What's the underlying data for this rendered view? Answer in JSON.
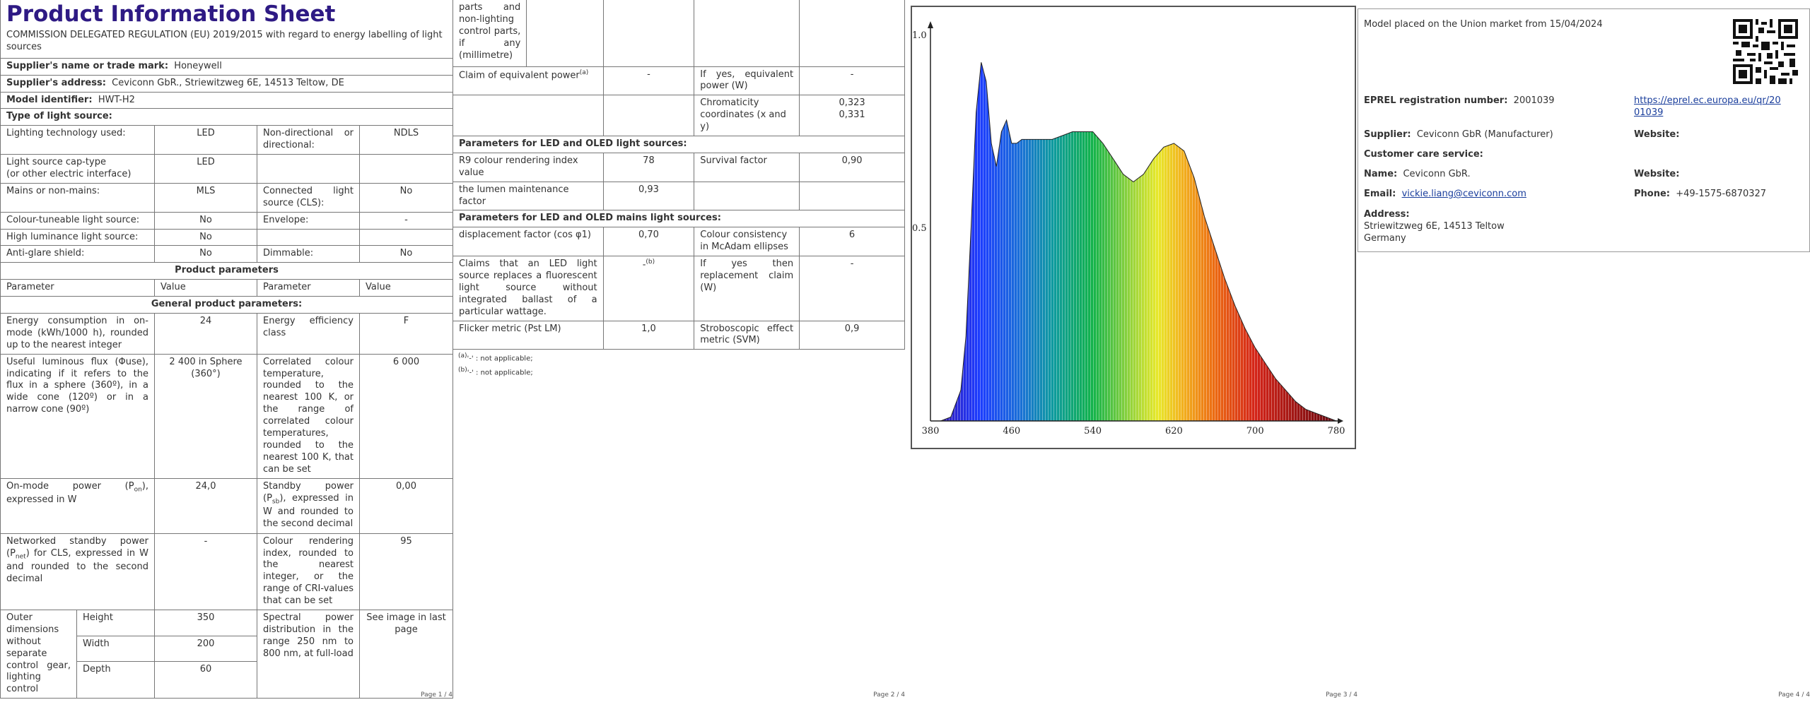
{
  "page1": {
    "title": "Product Information Sheet",
    "regulation": "COMMISSION DELEGATED REGULATION (EU) 2019/2015 with regard to energy labelling of light sources",
    "supplier_name_label": "Supplier's name or trade mark:",
    "supplier_name": "Honeywell",
    "supplier_address_label": "Supplier's address:",
    "supplier_address": "Ceviconn GbR., Striewitzweg 6E, 14513 Teltow, DE",
    "model_label": "Model identifier:",
    "model": "HWT-H2",
    "type_heading": "Type of light source:",
    "type_rows": [
      {
        "p1": "Lighting technology used:",
        "v1": "LED",
        "p2": "Non-directional or directional:",
        "v2": "NDLS"
      },
      {
        "p1": "Light source cap-type\n(or other electric interface)",
        "v1": "LED",
        "p2": "",
        "v2": ""
      },
      {
        "p1": "Mains or non-mains:",
        "v1": "MLS",
        "p2": "Connected light source (CLS):",
        "v2": "No"
      },
      {
        "p1": "Colour-tuneable light source:",
        "v1": "No",
        "p2": "Envelope:",
        "v2": "-"
      },
      {
        "p1": "High luminance light source:",
        "v1": "No",
        "p2": "",
        "v2": ""
      },
      {
        "p1": "Anti-glare shield:",
        "v1": "No",
        "p2": "Dimmable:",
        "v2": "No"
      }
    ],
    "product_params_heading": "Product parameters",
    "col_parameter": "Parameter",
    "col_value": "Value",
    "col_parameter2": "Parameter",
    "col_value2": "Value",
    "general_heading": "General product parameters:",
    "energy_label": "Energy consumption in on-mode (kWh/1000 h), rounded up to the nearest integer",
    "energy_value": "24",
    "eff_class_label": "Energy efficiency class",
    "eff_class_value": "F",
    "flux_label": "Useful luminous flux (Φuse), indicating if it refers to the flux in a sphere (360º), in a wide cone (120º) or in a narrow cone (90º)",
    "flux_value": "2 400 in Sphere (360°)",
    "cct_label": "Correlated colour temperature, rounded to the nearest 100 K, or the range of correlated colour temperatures, rounded to the nearest 100 K, that can be set",
    "cct_value": "6 000",
    "pon_label_a": "On-mode power (P",
    "pon_sub": "on",
    "pon_label_b": "), expressed in W",
    "pon_value": "24,0",
    "psb_label_a": "Standby power (P",
    "psb_sub": "sb",
    "psb_label_b": "), expressed in W and rounded to the second decimal",
    "psb_value": "0,00",
    "pnet_label_a": "Networked standby power (P",
    "pnet_sub": "net",
    "pnet_label_b": ") for CLS, expressed in W and rounded to the second decimal",
    "pnet_value": "-",
    "cri_label": "Colour rendering index, rounded to the nearest integer, or the range of CRI-values that can be set",
    "cri_value": "95",
    "outer_label": "Outer dimensions without separate control gear, lighting control",
    "height_label": "Height",
    "height_value": "350",
    "width_label": "Width",
    "width_value": "200",
    "depth_label": "Depth",
    "depth_value": "60",
    "spd_label": "Spectral power distribution in the range 250 nm to 800 nm, at full-load",
    "spd_value": "See image in last page",
    "page_num": "Page 1 / 4"
  },
  "page2": {
    "cont_text": "parts and non-lighting control parts, if any (millimetre)",
    "equiv_claim_label": "Claim of equivalent power",
    "equiv_claim_sup": "(a)",
    "equiv_claim_value": "-",
    "equiv_power_label": "If yes, equivalent power (W)",
    "equiv_power_value": "-",
    "chroma_label": "Chromaticity coordinates (x and y)",
    "chroma_x": "0,323",
    "chroma_y": "0,331",
    "led_heading": "Parameters for LED and OLED light sources:",
    "r9_label": "R9 colour rendering index value",
    "r9_value": "78",
    "survival_label": "Survival factor",
    "survival_value": "0,90",
    "lumen_label": "the lumen maintenance factor",
    "lumen_value": "0,93",
    "mains_heading": "Parameters for LED and OLED mains light sources:",
    "disp_label": "displacement factor (cos φ1)",
    "disp_value": "0,70",
    "consistency_label": "Colour consistency in McAdam ellipses",
    "consistency_value": "6",
    "claims_label": "Claims that an LED light source replaces a fluorescent light source without integrated ballast of a particular wattage.",
    "claims_value": "-",
    "claims_sup": "(b)",
    "replacement_label": "If yes then replacement claim (W)",
    "replacement_value": "-",
    "flicker_label": "Flicker metric (Pst LM)",
    "flicker_value": "1,0",
    "strobo_label": "Stroboscopic effect metric (SVM)",
    "strobo_value": "0,9",
    "foot_a_sup": "(a)",
    "foot_a": "'-' : not applicable;",
    "foot_b_sup": "(b)",
    "foot_b": "'-' : not applicable;",
    "page_num": "Page 2 / 4"
  },
  "page3": {
    "page_num": "Page 3 / 4"
  },
  "chart_data": {
    "type": "area",
    "title": "",
    "xlabel": "",
    "ylabel": "",
    "xlim": [
      380,
      780
    ],
    "ylim": [
      0,
      1.0
    ],
    "x_ticks": [
      "380",
      "460",
      "540",
      "620",
      "700",
      "780"
    ],
    "y_ticks": [
      "1.0",
      "0.5"
    ],
    "x": [
      380,
      390,
      400,
      410,
      415,
      420,
      425,
      430,
      435,
      440,
      445,
      450,
      455,
      460,
      465,
      470,
      475,
      480,
      490,
      500,
      510,
      520,
      530,
      540,
      550,
      560,
      570,
      580,
      590,
      600,
      610,
      620,
      630,
      640,
      650,
      660,
      670,
      680,
      690,
      700,
      710,
      720,
      730,
      740,
      750,
      760,
      770,
      780
    ],
    "values": [
      0,
      0,
      0.01,
      0.08,
      0.22,
      0.5,
      0.8,
      0.93,
      0.88,
      0.72,
      0.66,
      0.75,
      0.78,
      0.72,
      0.72,
      0.73,
      0.73,
      0.73,
      0.73,
      0.73,
      0.74,
      0.75,
      0.75,
      0.75,
      0.72,
      0.68,
      0.64,
      0.62,
      0.64,
      0.68,
      0.71,
      0.72,
      0.7,
      0.63,
      0.53,
      0.45,
      0.37,
      0.3,
      0.24,
      0.19,
      0.15,
      0.11,
      0.08,
      0.05,
      0.03,
      0.02,
      0.01,
      0.0
    ],
    "grid": false
  },
  "page4": {
    "placed_text": "Model placed on the Union market from 15/04/2024",
    "eprel_label": "EPREL registration number:",
    "eprel_value": "2001039",
    "eprel_link": "https://eprel.ec.europa.eu/qr/2001039",
    "eprel_link_line1": "https://eprel.ec.europa.eu/qr/20",
    "eprel_link_line2": "01039",
    "supplier_label": "Supplier:",
    "supplier_value": "Ceviconn GbR (Manufacturer)",
    "website_label": "Website:",
    "care_heading": "Customer care service:",
    "name_label": "Name:",
    "name_value": "Ceviconn GbR.",
    "website_label2": "Website:",
    "email_label": "Email:",
    "email_value": "vickie.liang@ceviconn.com",
    "phone_label": "Phone:",
    "phone_value": "+49-1575-6870327",
    "address_label": "Address:",
    "address_line1": "Striewitzweg 6E, 14513 Teltow",
    "address_line2": "Germany",
    "page_num": "Page 4 / 4"
  }
}
